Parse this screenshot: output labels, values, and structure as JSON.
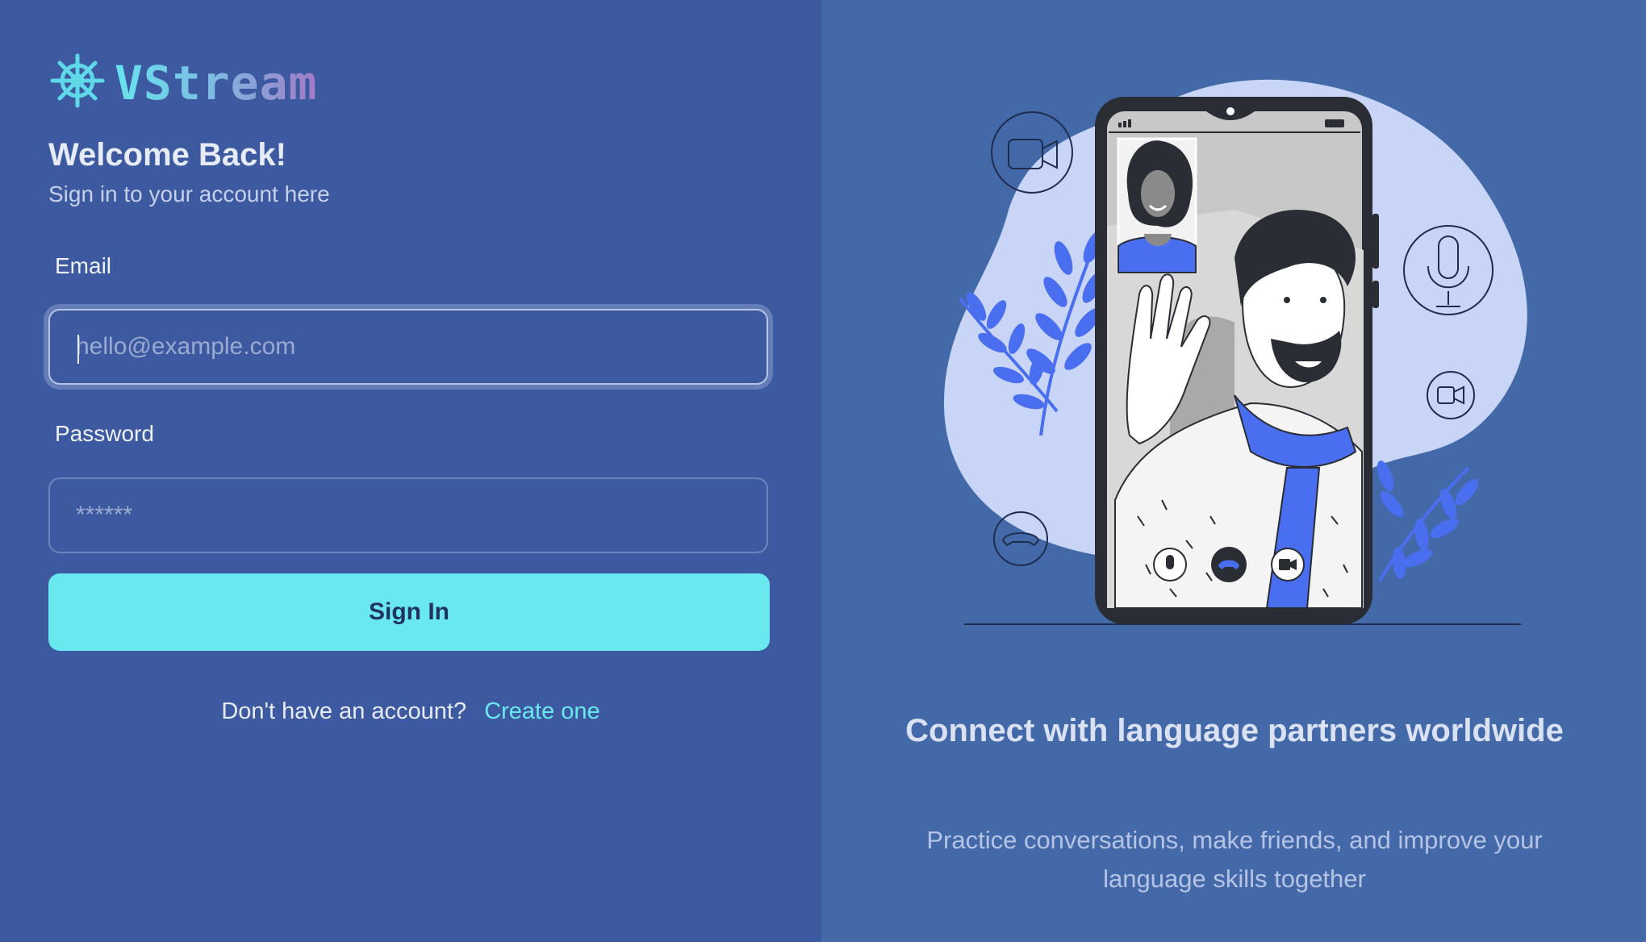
{
  "brand": {
    "name": "VStream",
    "icon": "ship-wheel-icon",
    "gradient": [
      "#67e3ef",
      "#7bbfe3",
      "#a27bc6"
    ]
  },
  "login": {
    "title": "Welcome Back!",
    "subtitle": "Sign in to your account here",
    "email_label": "Email",
    "email_placeholder": "hello@example.com",
    "email_value": "",
    "password_label": "Password",
    "password_placeholder": "******",
    "password_value": "",
    "submit_label": "Sign In",
    "signup_prompt": "Don't have an account?",
    "signup_link": "Create one"
  },
  "promo": {
    "headline": "Connect with language partners worldwide",
    "description": "Practice conversations, make friends, and improve your language skills together",
    "illustration": "video-call-illustration"
  },
  "colors": {
    "left_bg": "#3d5aa0",
    "right_bg": "#4369a8",
    "accent": "#6ae8ef",
    "blob": "#c8d4f6",
    "illustration_blue": "#4a6ef0",
    "phone_dark": "#2a2d33"
  }
}
